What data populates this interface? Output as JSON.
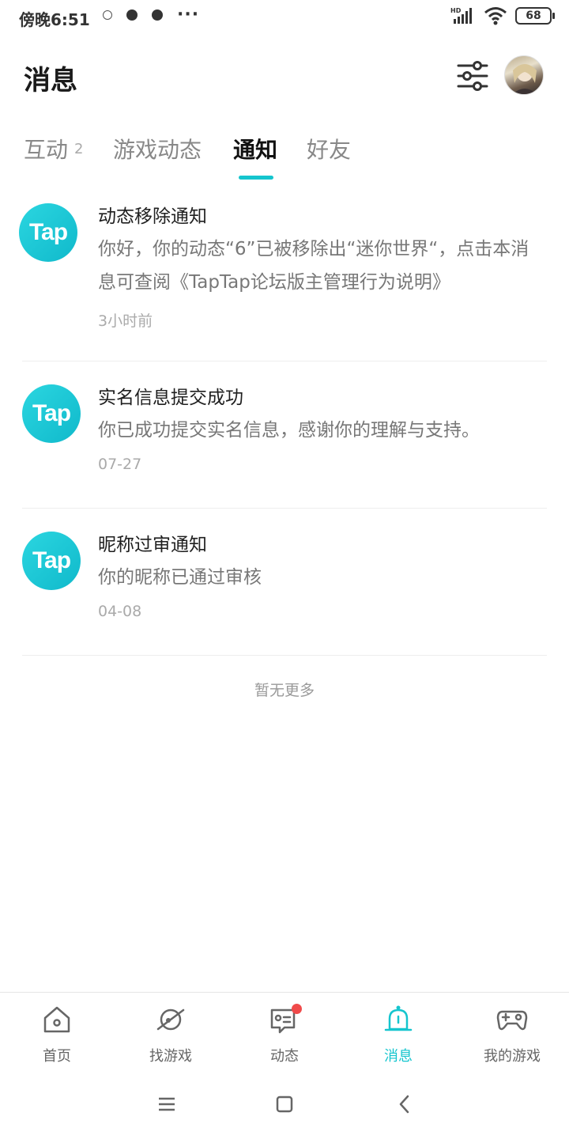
{
  "status_bar": {
    "time": "傍晚6:51",
    "network": "HD",
    "battery": "68"
  },
  "header": {
    "title": "消息"
  },
  "tabs": [
    {
      "label": "互动",
      "count": "2"
    },
    {
      "label": "游戏动态"
    },
    {
      "label": "通知"
    },
    {
      "label": "好友"
    }
  ],
  "notifications": [
    {
      "logo": "Tap",
      "title": "动态移除通知",
      "text": "你好，你的动态“6”已被移除出“迷你世界“，点击本消息可查阅《TapTap论坛版主管理行为说明》",
      "time": "3小时前"
    },
    {
      "logo": "Tap",
      "title": "实名信息提交成功",
      "text": "你已成功提交实名信息，感谢你的理解与支持。",
      "time": "07-27"
    },
    {
      "logo": "Tap",
      "title": "昵称过审通知",
      "text": "你的昵称已通过审核",
      "time": "04-08"
    }
  ],
  "footer_text": "暂无更多",
  "bottom_nav": [
    {
      "label": "首页",
      "icon": "home-icon"
    },
    {
      "label": "找游戏",
      "icon": "planet-icon"
    },
    {
      "label": "动态",
      "icon": "chat-icon"
    },
    {
      "label": "消息",
      "icon": "bell-icon"
    },
    {
      "label": "我的游戏",
      "icon": "gamepad-icon"
    }
  ],
  "colors": {
    "accent": "#15c5ce",
    "badge": "#f04a4a"
  }
}
